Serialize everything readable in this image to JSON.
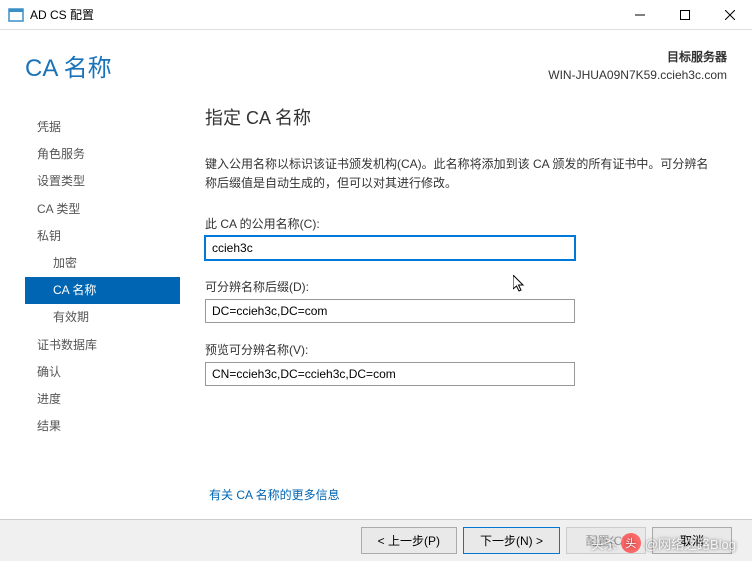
{
  "titlebar": {
    "title": "AD CS 配置"
  },
  "header": {
    "wizard_title": "CA 名称",
    "target_label": "目标服务器",
    "target_server": "WIN-JHUA09N7K59.ccieh3c.com"
  },
  "sidebar": {
    "items": [
      {
        "label": "凭据",
        "indent": false,
        "active": false
      },
      {
        "label": "角色服务",
        "indent": false,
        "active": false
      },
      {
        "label": "设置类型",
        "indent": false,
        "active": false
      },
      {
        "label": "CA 类型",
        "indent": false,
        "active": false
      },
      {
        "label": "私钥",
        "indent": false,
        "active": false
      },
      {
        "label": "加密",
        "indent": true,
        "active": false
      },
      {
        "label": "CA 名称",
        "indent": true,
        "active": true
      },
      {
        "label": "有效期",
        "indent": true,
        "active": false
      },
      {
        "label": "证书数据库",
        "indent": false,
        "active": false
      },
      {
        "label": "确认",
        "indent": false,
        "active": false
      },
      {
        "label": "进度",
        "indent": false,
        "active": false
      },
      {
        "label": "结果",
        "indent": false,
        "active": false
      }
    ]
  },
  "main": {
    "section_title": "指定 CA 名称",
    "description": "键入公用名称以标识该证书颁发机构(CA)。此名称将添加到该 CA 颁发的所有证书中。可分辨名称后缀值是自动生成的，但可以对其进行修改。",
    "field1_label": "此 CA 的公用名称(C):",
    "field1_value": "ccieh3c",
    "field2_label": "可分辨名称后缀(D):",
    "field2_value": "DC=ccieh3c,DC=com",
    "field3_label": "预览可分辨名称(V):",
    "field3_value": "CN=ccieh3c,DC=ccieh3c,DC=com",
    "more_link": "有关 CA 名称的更多信息"
  },
  "buttons": {
    "prev": "< 上一步(P)",
    "next": "下一步(N) >",
    "configure": "配置(C)",
    "cancel": "取消"
  },
  "watermark": {
    "prefix": "头杀",
    "author": "@网络之路Blog"
  }
}
